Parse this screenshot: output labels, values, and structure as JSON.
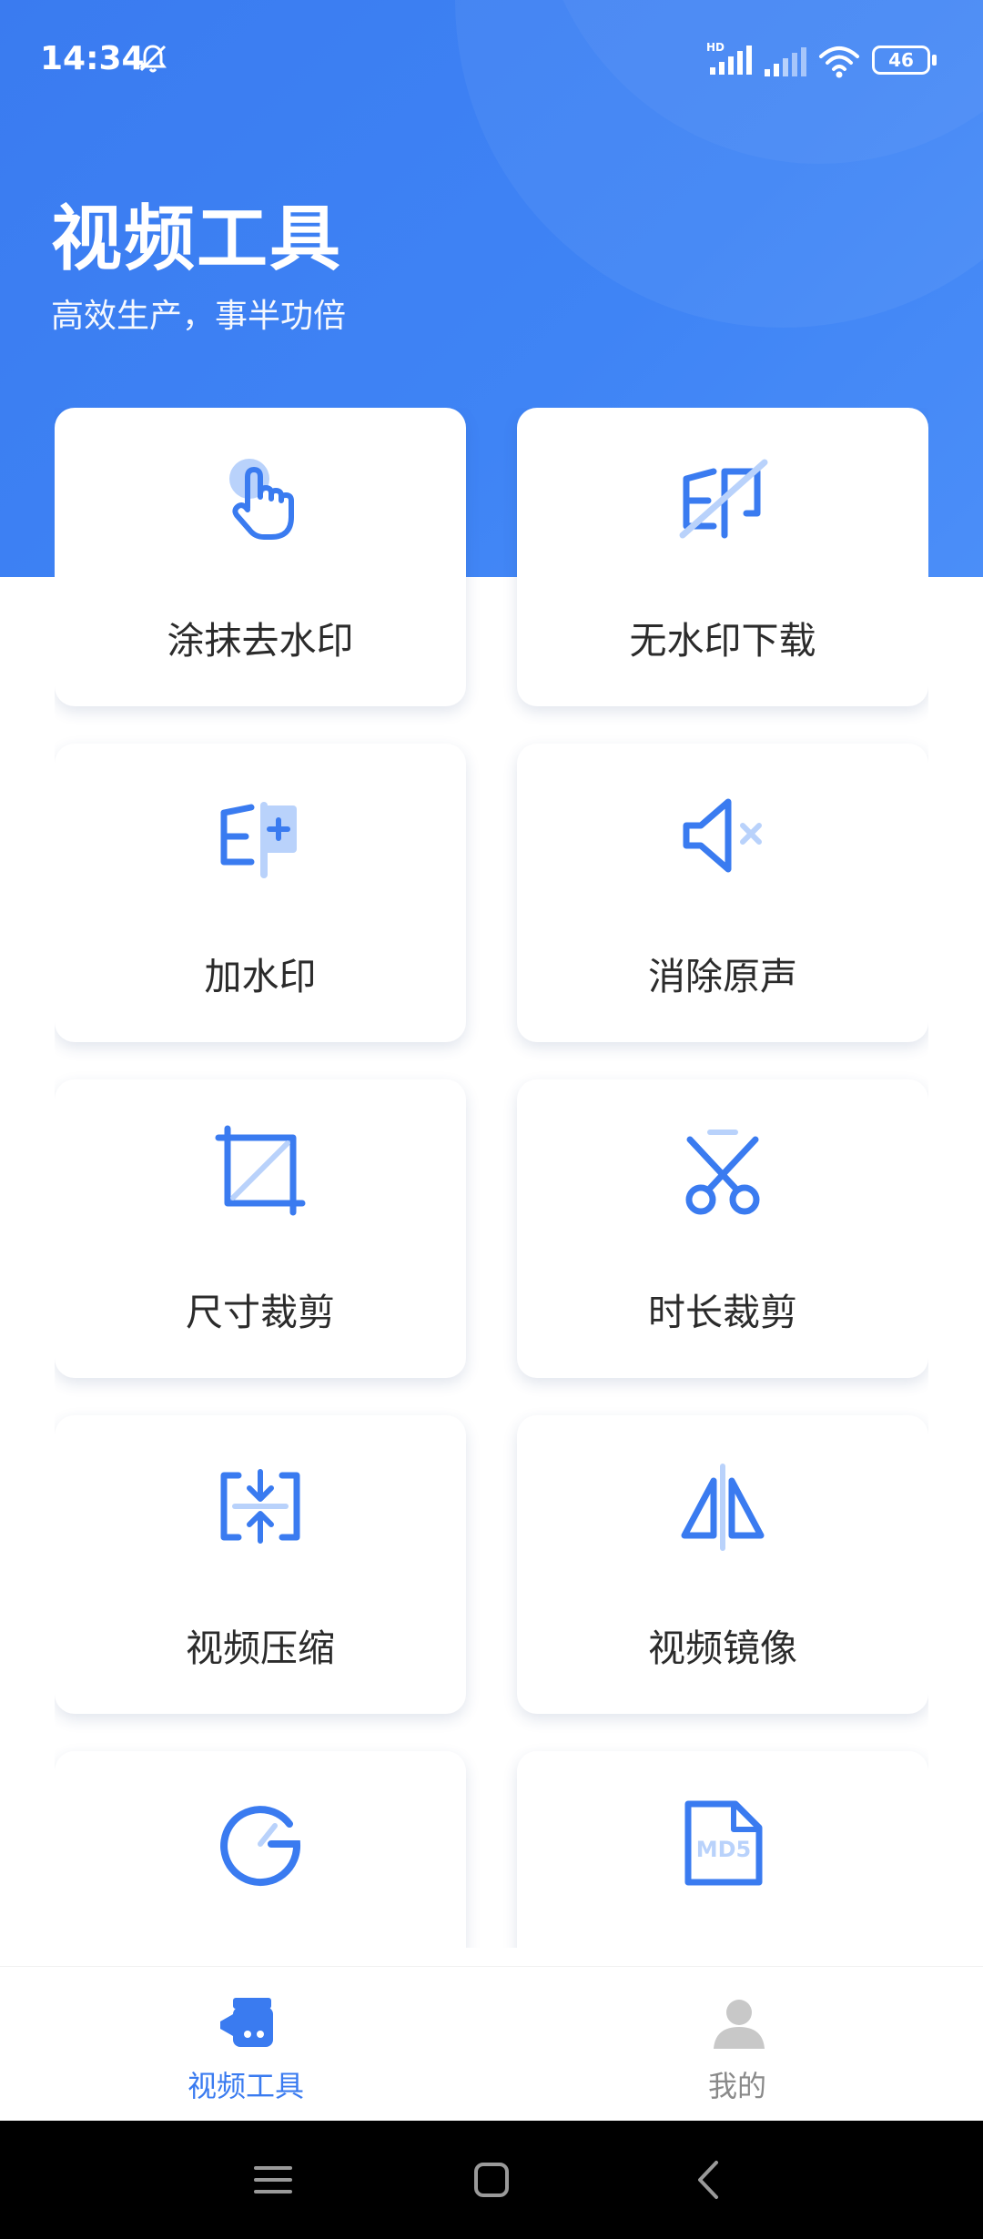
{
  "status_bar": {
    "time": "14:34",
    "battery": "46",
    "network_badge": "HD"
  },
  "header": {
    "title": "视频工具",
    "subtitle": "高效生产，事半功倍"
  },
  "tools": [
    {
      "label": "涂抹去水印",
      "icon": "tap-hand-icon"
    },
    {
      "label": "无水印下载",
      "icon": "no-watermark-icon"
    },
    {
      "label": "加水印",
      "icon": "add-watermark-icon"
    },
    {
      "label": "消除原声",
      "icon": "mute-icon"
    },
    {
      "label": "尺寸裁剪",
      "icon": "crop-icon"
    },
    {
      "label": "时长裁剪",
      "icon": "scissors-icon"
    },
    {
      "label": "视频压缩",
      "icon": "compress-icon"
    },
    {
      "label": "视频镜像",
      "icon": "mirror-icon"
    },
    {
      "label": "",
      "icon": "speed-gauge-icon"
    },
    {
      "label": "",
      "icon": "md5-file-icon"
    }
  ],
  "tabbar": {
    "items": [
      {
        "label": "视频工具",
        "icon": "video-tools-icon",
        "active": true
      },
      {
        "label": "我的",
        "icon": "profile-icon",
        "active": false
      }
    ]
  },
  "colors": {
    "primary": "#3a7bf0",
    "icon_light": "#b9d2fb",
    "tab_inactive": "#8a8a8a",
    "text": "#2b2b2b"
  }
}
